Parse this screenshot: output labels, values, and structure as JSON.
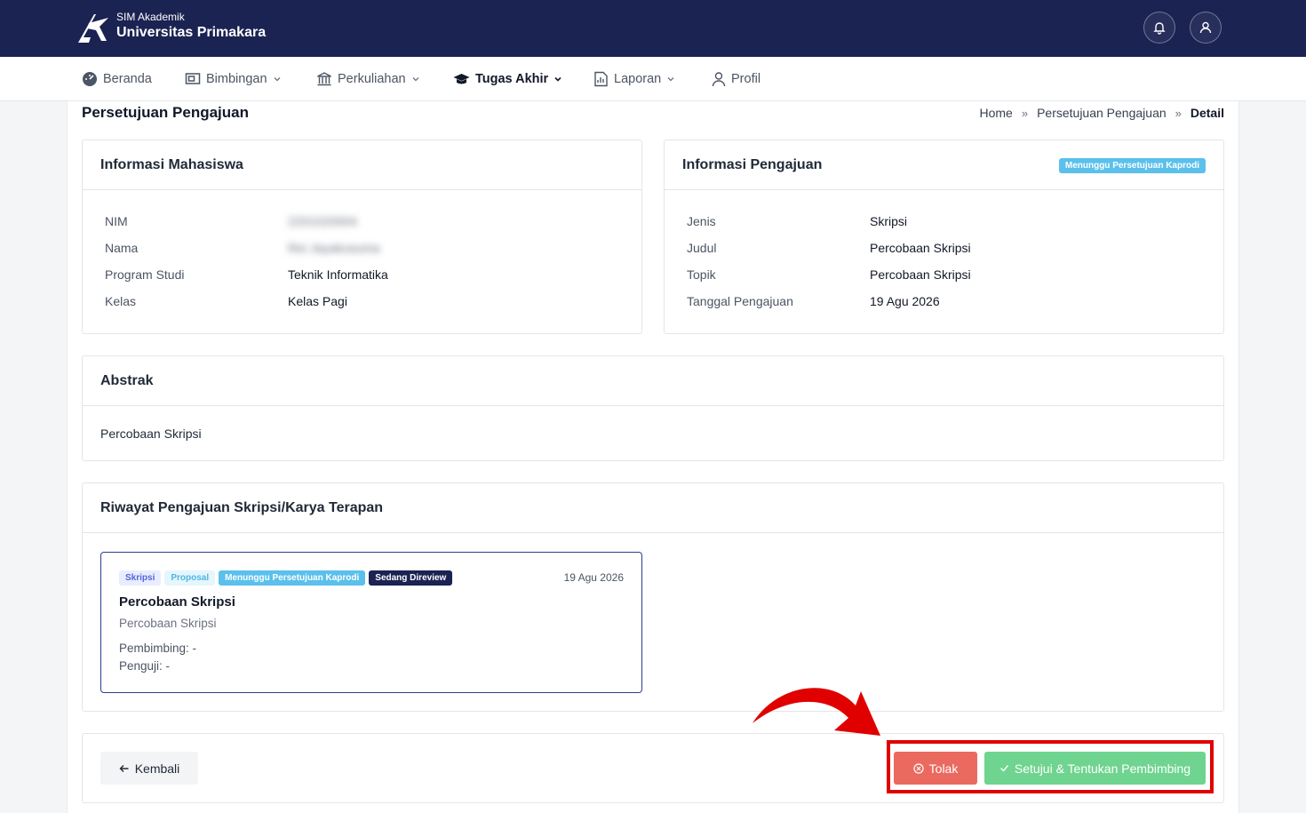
{
  "header": {
    "brand_sub": "SIM Akademik",
    "brand_main": "Universitas Primakara"
  },
  "nav": {
    "items": [
      {
        "label": "Beranda",
        "icon": "dashboard-icon"
      },
      {
        "label": "Bimbingan",
        "icon": "presentation-icon"
      },
      {
        "label": "Perkuliahan",
        "icon": "building-icon"
      },
      {
        "label": "Tugas Akhir",
        "icon": "graduation-cap-icon"
      },
      {
        "label": "Laporan",
        "icon": "report-icon"
      },
      {
        "label": "Profil",
        "icon": "user-icon"
      }
    ]
  },
  "page": {
    "title": "Persetujuan Pengajuan",
    "breadcrumb": [
      "Home",
      "Persetujuan Pengajuan",
      "Detail"
    ]
  },
  "student_info": {
    "title": "Informasi Mahasiswa",
    "rows": [
      {
        "label": "NIM",
        "value": "2201020004"
      },
      {
        "label": "Nama",
        "value": "Rei Jayakusuma"
      },
      {
        "label": "Program Studi",
        "value": "Teknik Informatika"
      },
      {
        "label": "Kelas",
        "value": "Kelas Pagi"
      }
    ]
  },
  "submission_info": {
    "title": "Informasi Pengajuan",
    "status": "Menunggu Persetujuan Kaprodi",
    "rows": [
      {
        "label": "Jenis",
        "value": "Skripsi"
      },
      {
        "label": "Judul",
        "value": "Percobaan Skripsi"
      },
      {
        "label": "Topik",
        "value": "Percobaan Skripsi"
      },
      {
        "label": "Tanggal Pengajuan",
        "value": "19 Agu 2026"
      }
    ]
  },
  "abstract": {
    "title": "Abstrak",
    "text": "Percobaan Skripsi"
  },
  "history": {
    "title": "Riwayat Pengajuan Skripsi/Karya Terapan",
    "items": [
      {
        "badges": [
          "Skripsi",
          "Proposal",
          "Menunggu Persetujuan Kaprodi",
          "Sedang Direview"
        ],
        "date": "19 Agu 2026",
        "title": "Percobaan Skripsi",
        "topic": "Percobaan Skripsi",
        "supervisor": "Pembimbing: -",
        "examiner": "Penguji: -"
      }
    ]
  },
  "actions": {
    "back": "Kembali",
    "reject": "Tolak",
    "approve": "Setujui & Tentukan Pembimbing"
  },
  "colors": {
    "header_bg": "#1b2352",
    "reject": "#ea6a60",
    "approve": "#6fd48f",
    "info_badge": "#5bc0eb",
    "annotation": "#e00000"
  }
}
